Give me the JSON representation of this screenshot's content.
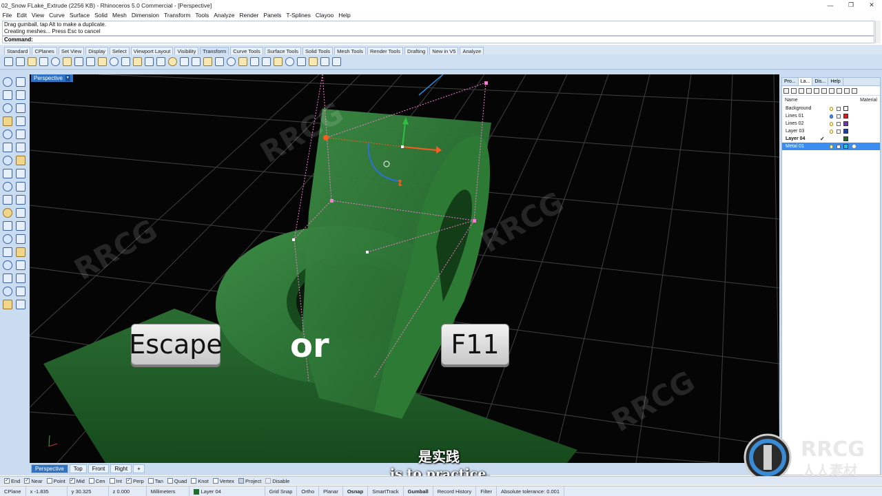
{
  "window": {
    "title": "02_Snow FLake_Extrude (2256 KB) - Rhinoceros 5.0 Commercial - [Perspective]",
    "minimize": "—",
    "restore": "❐",
    "close": "✕"
  },
  "menu": [
    "File",
    "Edit",
    "View",
    "Curve",
    "Surface",
    "Solid",
    "Mesh",
    "Dimension",
    "Transform",
    "Tools",
    "Analyze",
    "Render",
    "Panels",
    "T-Splines",
    "Clayoo",
    "Help"
  ],
  "command": {
    "history": [
      "Drag gumball, tap Alt to make a duplicate.",
      "Creating meshes... Press Esc to cancel"
    ],
    "prompt": "Command:"
  },
  "toolbar_tabs": [
    "Standard",
    "CPlanes",
    "Set View",
    "Display",
    "Select",
    "Viewport Layout",
    "Visibility",
    "Transform",
    "Curve Tools",
    "Surface Tools",
    "Solid Tools",
    "Mesh Tools",
    "Render Tools",
    "Drafting",
    "New in V5",
    "Analyze"
  ],
  "active_toolbar_tab": "Transform",
  "viewport": {
    "label": "Perspective",
    "keys": {
      "left": "Escape",
      "right": "F11"
    },
    "or_text": "or",
    "tabs": [
      "Perspective",
      "Top",
      "Front",
      "Right"
    ],
    "add_tab": "+"
  },
  "subtitles": {
    "cn": "是实践",
    "en": "is to practice."
  },
  "panel": {
    "tabs": [
      "Pro...",
      "La...",
      "Dis...",
      "Help"
    ],
    "col_name": "Name",
    "col_material": "Material",
    "layers": [
      {
        "name": "Background",
        "color": "#ffffff"
      },
      {
        "name": "Lines 01",
        "color": "#d42020"
      },
      {
        "name": "Lines 02",
        "color": "#7a2fbf"
      },
      {
        "name": "Layer 03",
        "color": "#1f3fa8"
      },
      {
        "name": "Layer 04",
        "color": "#1e6e2e",
        "current": true,
        "check": "✓"
      },
      {
        "name": "Metal 01",
        "color": "#29c3e8",
        "selected": true
      }
    ]
  },
  "osnaps": [
    {
      "label": "End",
      "on": true
    },
    {
      "label": "Near",
      "on": true
    },
    {
      "label": "Point",
      "on": false
    },
    {
      "label": "Mid",
      "on": true
    },
    {
      "label": "Cen",
      "on": false
    },
    {
      "label": "Int",
      "on": false
    },
    {
      "label": "Perp",
      "on": true
    },
    {
      "label": "Tan",
      "on": false
    },
    {
      "label": "Quad",
      "on": false
    },
    {
      "label": "Knot",
      "on": false
    },
    {
      "label": "Vertex",
      "on": false
    },
    {
      "label": "Project",
      "on": false
    },
    {
      "label": "Disable",
      "on": false
    }
  ],
  "status": {
    "cplane": "CPlane",
    "x": "x -1.835",
    "y": "y 30.325",
    "z": "z 0.000",
    "units": "Millimeters",
    "layer": "Layer 04",
    "grid_snap": "Grid Snap",
    "ortho": "Ortho",
    "planar": "Planar",
    "osnap": "Osnap",
    "smarttrack": "SmartTrack",
    "gumball": "Gumball",
    "record_history": "Record History",
    "filter": "Filter",
    "tolerance": "Absolute tolerance: 0.001"
  },
  "colors": {
    "object_green": "#2e7d3a",
    "viewport_bg": "#050505",
    "accent_blue": "#2f72c4"
  }
}
